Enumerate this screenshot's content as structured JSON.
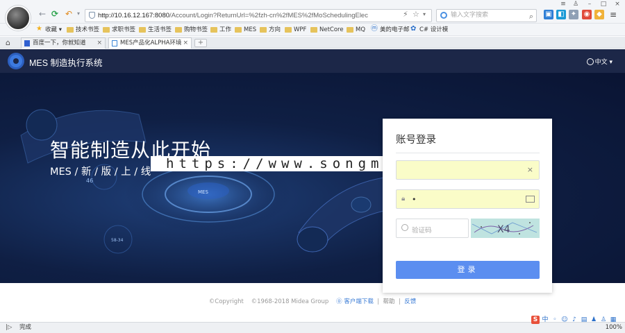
{
  "browser": {
    "address": {
      "host": "http://10.16.12.167:8080",
      "path": "/Account/Login?ReturnUrl=%2fzh-cn%2fMES%2fMoSchedulingElec"
    },
    "search": {
      "placeholder": "输入文字搜索"
    },
    "bookmarks": [
      "收藏",
      "技术书签",
      "求职书签",
      "生活书签",
      "购物书签",
      "工作",
      "MES",
      "方向",
      "WPF",
      "NetCore",
      "MQ",
      "美的电子邮",
      "C# 设计模"
    ],
    "tabs": [
      {
        "label": "百度一下，你就知道",
        "active": false
      },
      {
        "label": "MES产品化ALPHA环境",
        "active": true
      }
    ],
    "status_text": "完成",
    "zoom": "100%"
  },
  "app": {
    "title": "MES 制造执行系统",
    "language": "中文"
  },
  "hero": {
    "title": "智能制造从此开始",
    "subtitle": "MES / 新 / 版 / 上 / 线",
    "watermark": "https://www.songma.com"
  },
  "login": {
    "title": "账号登录",
    "username_value": "",
    "password_value": "•",
    "captcha_placeholder": "验证码",
    "captcha_text": "X4",
    "submit_label": "登录"
  },
  "footer": {
    "copyright": "©Copyright",
    "years": "©1968-2018 Midea Group",
    "download": "客户端下载",
    "help": "帮助",
    "feedback": "反馈"
  },
  "colors": {
    "header": "#1c2748",
    "button": "#5b8ef0",
    "autofill": "#fafcc8"
  }
}
